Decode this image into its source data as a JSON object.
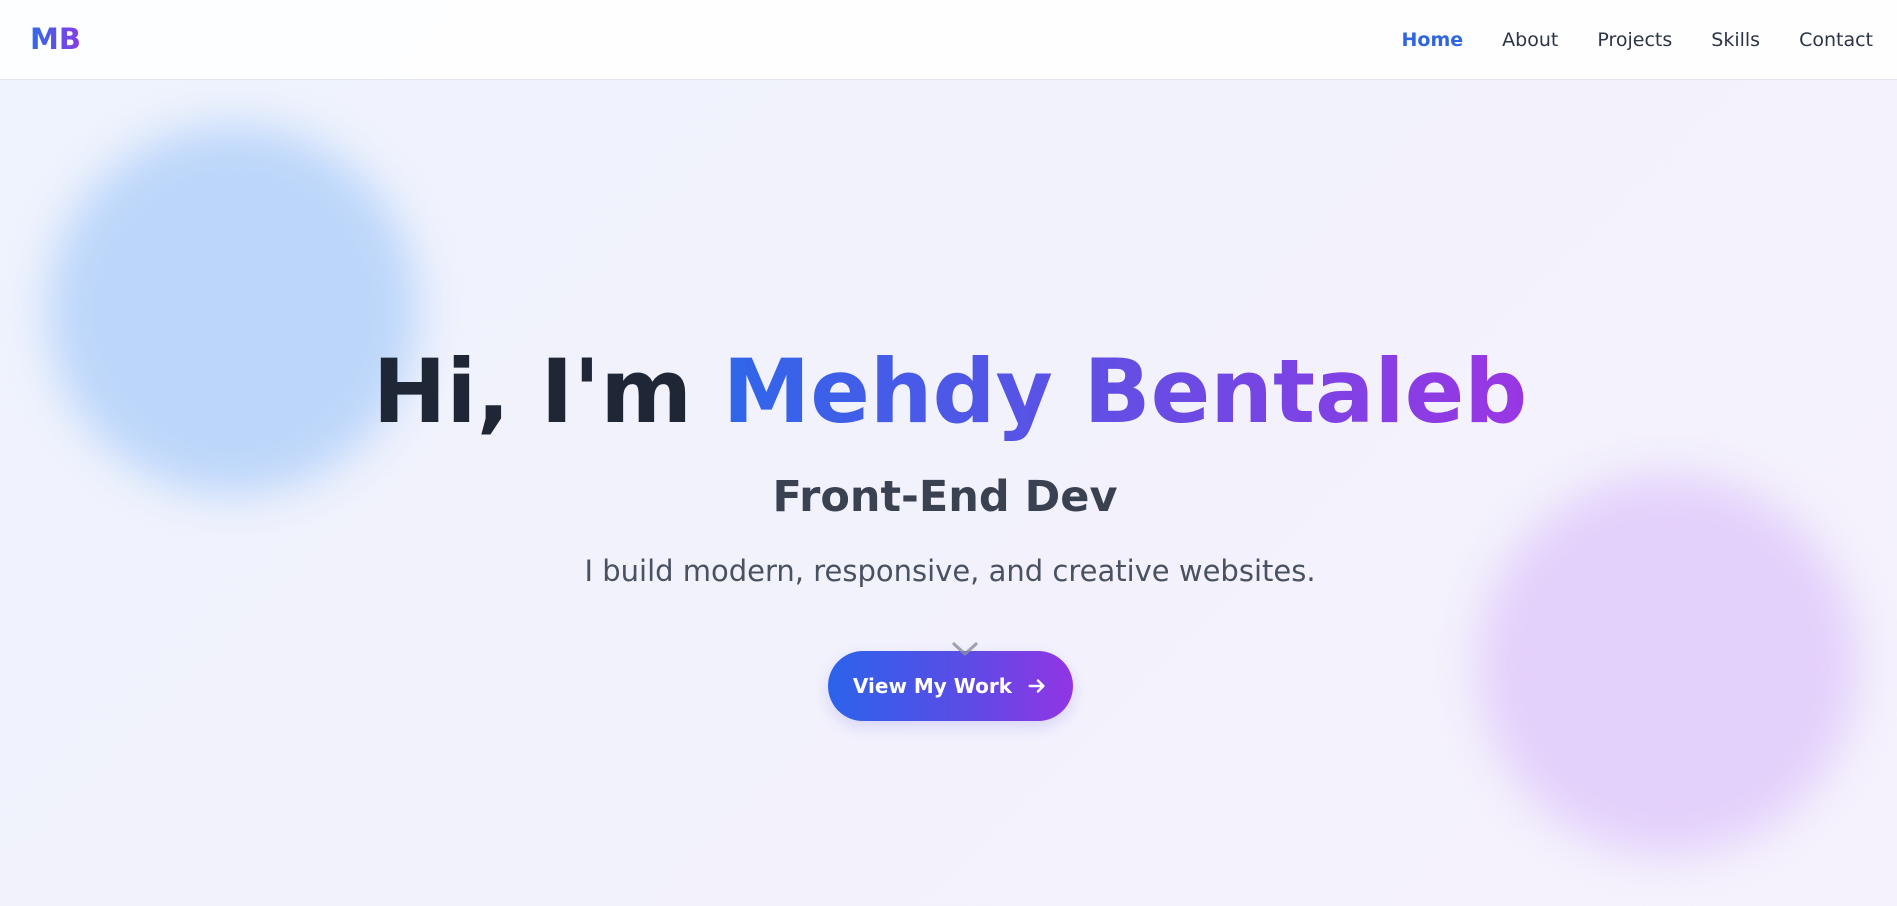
{
  "nav": {
    "logo": "MB",
    "links": [
      {
        "label": "Home",
        "active": true
      },
      {
        "label": "About",
        "active": false
      },
      {
        "label": "Projects",
        "active": false
      },
      {
        "label": "Skills",
        "active": false
      },
      {
        "label": "Contact",
        "active": false
      }
    ]
  },
  "hero": {
    "greeting": "Hi, I'm ",
    "name": "Mehdy Bentaleb",
    "subtitle": "Front-End Dev",
    "tagline": "I build modern, responsive, and creative websites.",
    "cta_label": "View My Work",
    "cta_icon": "arrow-right-icon",
    "scroll_icon": "chevron-down-icon"
  },
  "colors": {
    "accent_blue": "#2f66e0",
    "accent_purple": "#9235e4",
    "text_dark": "#1f2736",
    "blob_blue": "#bcd6fa",
    "blob_purple": "#e3d0fb"
  }
}
